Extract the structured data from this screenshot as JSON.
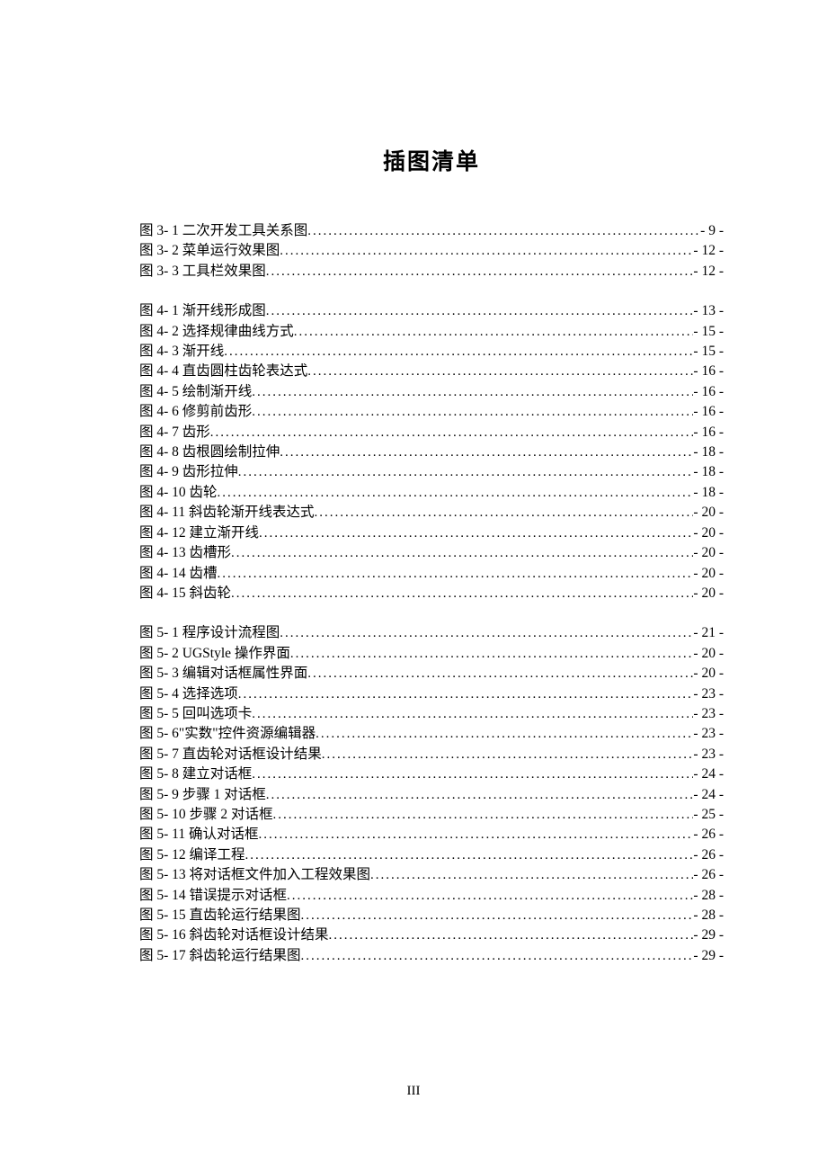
{
  "title": "插图清单",
  "page_number": "III",
  "groups": [
    [
      {
        "label": "图 3- 1 二次开发工具关系图",
        "page": "- 9 -"
      },
      {
        "label": "图 3- 2 菜单运行效果图",
        "page": "- 12 -"
      },
      {
        "label": "图 3- 3 工具栏效果图",
        "page": "- 12 -"
      }
    ],
    [
      {
        "label": "图 4- 1 渐开线形成图",
        "page": "- 13 -"
      },
      {
        "label": "图 4- 2 选择规律曲线方式",
        "page": "- 15 -"
      },
      {
        "label": "图 4- 3 渐开线",
        "page": "- 15 -"
      },
      {
        "label": "图 4- 4 直齿圆柱齿轮表达式",
        "page": "- 16 -"
      },
      {
        "label": "图 4- 5 绘制渐开线",
        "page": "- 16 -"
      },
      {
        "label": "图 4- 6 修剪前齿形",
        "page": "- 16 -"
      },
      {
        "label": "图 4- 7 齿形",
        "page": "- 16 -"
      },
      {
        "label": "图 4- 8 齿根圆绘制拉伸",
        "page": "- 18 -"
      },
      {
        "label": "图 4- 9 齿形拉伸",
        "page": "- 18 -"
      },
      {
        "label": "图 4- 10 齿轮",
        "page": "- 18 -"
      },
      {
        "label": "图 4- 11 斜齿轮渐开线表达式",
        "page": "- 20 -"
      },
      {
        "label": "图 4- 12 建立渐开线",
        "page": "- 20 -"
      },
      {
        "label": "图 4- 13 齿槽形",
        "page": "- 20 -"
      },
      {
        "label": "图 4- 14 齿槽",
        "page": "- 20 -"
      },
      {
        "label": "图 4- 15 斜齿轮",
        "page": "- 20 -"
      }
    ],
    [
      {
        "label": "图 5- 1 程序设计流程图",
        "page": "- 21 -"
      },
      {
        "label": "图 5- 2 UGStyle  操作界面",
        "page": "- 20 -"
      },
      {
        "label": "图 5- 3 编辑对话框属性界面",
        "page": "- 20 -"
      },
      {
        "label": "图 5- 4 选择选项",
        "page": "- 23 -"
      },
      {
        "label": "图 5- 5 回叫选项卡",
        "page": "- 23 -"
      },
      {
        "label": "图 5- 6\"实数\"控件资源编辑器",
        "page": "- 23 -"
      },
      {
        "label": "图 5- 7 直齿轮对话框设计结果",
        "page": "- 23 -"
      },
      {
        "label": "图 5- 8 建立对话框",
        "page": "- 24 -"
      },
      {
        "label": "图 5- 9 步骤 1 对话框",
        "page": "- 24 -"
      },
      {
        "label": "图 5- 10 步骤 2 对话框",
        "page": "- 25 -"
      },
      {
        "label": "图 5- 11 确认对话框",
        "page": "- 26 -"
      },
      {
        "label": "图 5- 12 编译工程",
        "page": "- 26 -"
      },
      {
        "label": "图 5- 13 将对话框文件加入工程效果图",
        "page": "- 26 -"
      },
      {
        "label": "图 5- 14 错误提示对话框",
        "page": "- 28 -"
      },
      {
        "label": "图 5- 15 直齿轮运行结果图",
        "page": "- 28 -"
      },
      {
        "label": "图 5- 16 斜齿轮对话框设计结果",
        "page": "- 29 -"
      },
      {
        "label": "图 5- 17 斜齿轮运行结果图",
        "page": "- 29 -"
      }
    ]
  ]
}
